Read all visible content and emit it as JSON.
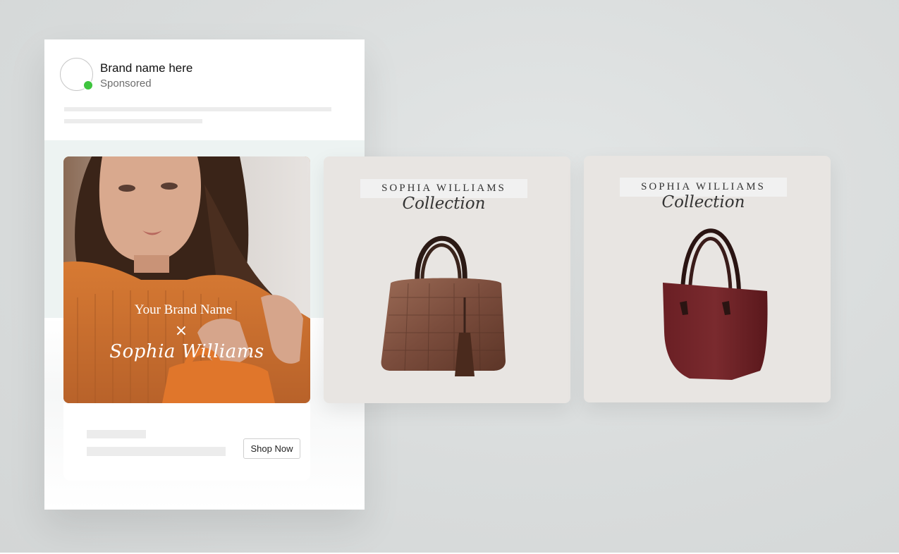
{
  "post": {
    "brand_name": "Brand name here",
    "sponsored_label": "Sponsored",
    "cta_label": "Shop Now"
  },
  "slides": [
    {
      "overlay_brand": "Your Brand Name",
      "overlay_separator": "×",
      "overlay_partner": "Sophia Williams"
    },
    {
      "label_title": "SOPHIA WILLIAMS",
      "label_subtitle": "Collection",
      "product": "brown-croc-handbag"
    },
    {
      "label_title": "SOPHIA WILLIAMS",
      "label_subtitle": "Collection",
      "product": "burgundy-leather-tote"
    }
  ],
  "colors": {
    "background": "#d9dcdc",
    "online_status": "#3ec43e",
    "slide_background": "#e8e5e2",
    "sweater_orange": "#c97a3c"
  }
}
